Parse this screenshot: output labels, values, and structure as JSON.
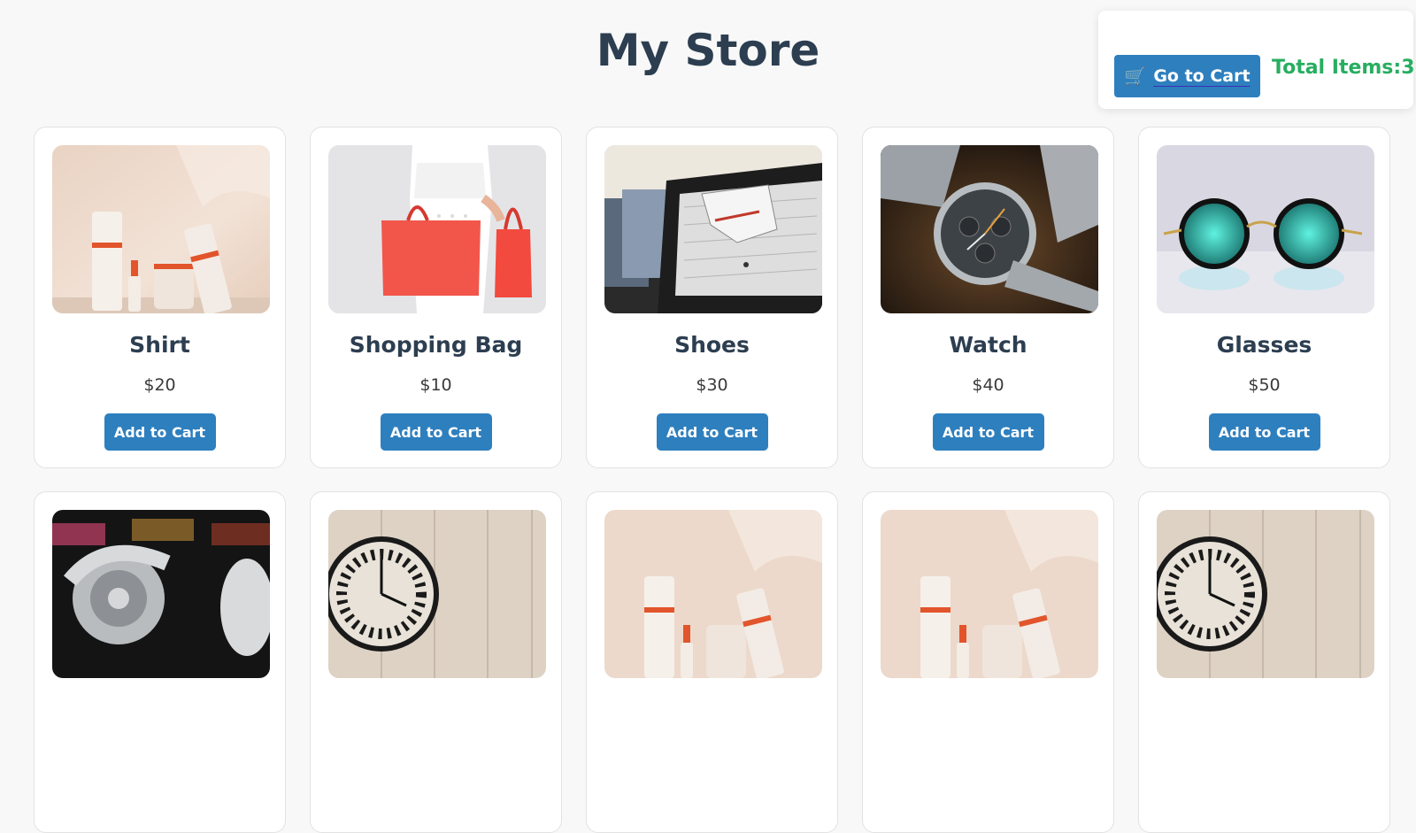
{
  "page": {
    "title": "My Store"
  },
  "cart": {
    "button_label": "Go to Cart",
    "cart_icon": "🛒",
    "total_label": "Total Items:3"
  },
  "colors": {
    "accent": "#2e7fbe",
    "title": "#2c3e50",
    "total": "#27ae60",
    "background": "#f8f8f8"
  },
  "products": [
    {
      "name": "Shirt",
      "price": "$20",
      "button": "Add to Cart",
      "image": "cosmetics"
    },
    {
      "name": "Shopping Bag",
      "price": "$10",
      "button": "Add to Cart",
      "image": "shopping-bag"
    },
    {
      "name": "Shoes",
      "price": "$30",
      "button": "Add to Cart",
      "image": "shirt"
    },
    {
      "name": "Watch",
      "price": "$40",
      "button": "Add to Cart",
      "image": "watch"
    },
    {
      "name": "Glasses",
      "price": "$50",
      "button": "Add to Cart",
      "image": "sunglasses"
    },
    {
      "image": "headphones"
    },
    {
      "image": "wall-clock"
    },
    {
      "image": "cosmetics"
    },
    {
      "image": "cosmetics"
    },
    {
      "image": "wall-clock"
    }
  ]
}
